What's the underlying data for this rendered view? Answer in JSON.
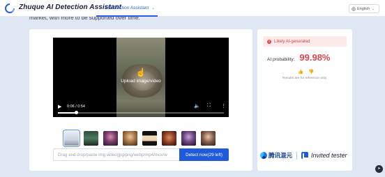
{
  "header": {
    "brand": "Zhuque AI Detection Assistant",
    "nav_tab": "AI Detection Assistant",
    "language": "English",
    "colors": {
      "accent": "#2b5ee6",
      "brand_text": "#1a1f36"
    }
  },
  "scrolled_text": "market, with more to be supported over time.",
  "player": {
    "upload_label": "Upload image/video",
    "time": "0:06 / 0:54",
    "progress_percent": 11,
    "icons": [
      "play-icon",
      "volume-icon",
      "fullscreen-icon",
      "more-icon"
    ]
  },
  "thumbnails": [
    {
      "label": "sample-1",
      "active": true
    },
    {
      "label": "sample-2"
    },
    {
      "label": "sample-3"
    },
    {
      "label": "sample-4"
    },
    {
      "label": "sample-5"
    },
    {
      "label": "sample-6"
    },
    {
      "label": "sample-7"
    },
    {
      "label": "sample-8"
    }
  ],
  "input": {
    "placeholder": "Drag and drop/paste img,video(jpg/png/webp/mp4/mov/w",
    "button": "Detect now(29 left)"
  },
  "result": {
    "verdict": "Likely AI-generated",
    "probability_label": "AI probability:",
    "probability_value": "99.98%",
    "note": "Results are for reference only.",
    "colors": {
      "verdict": "#d8413f",
      "verdict_bg": "#fde9ea",
      "probability": "#e0484a"
    }
  },
  "partners": {
    "tencent": "腾讯混元",
    "invited": "Invited tester"
  }
}
